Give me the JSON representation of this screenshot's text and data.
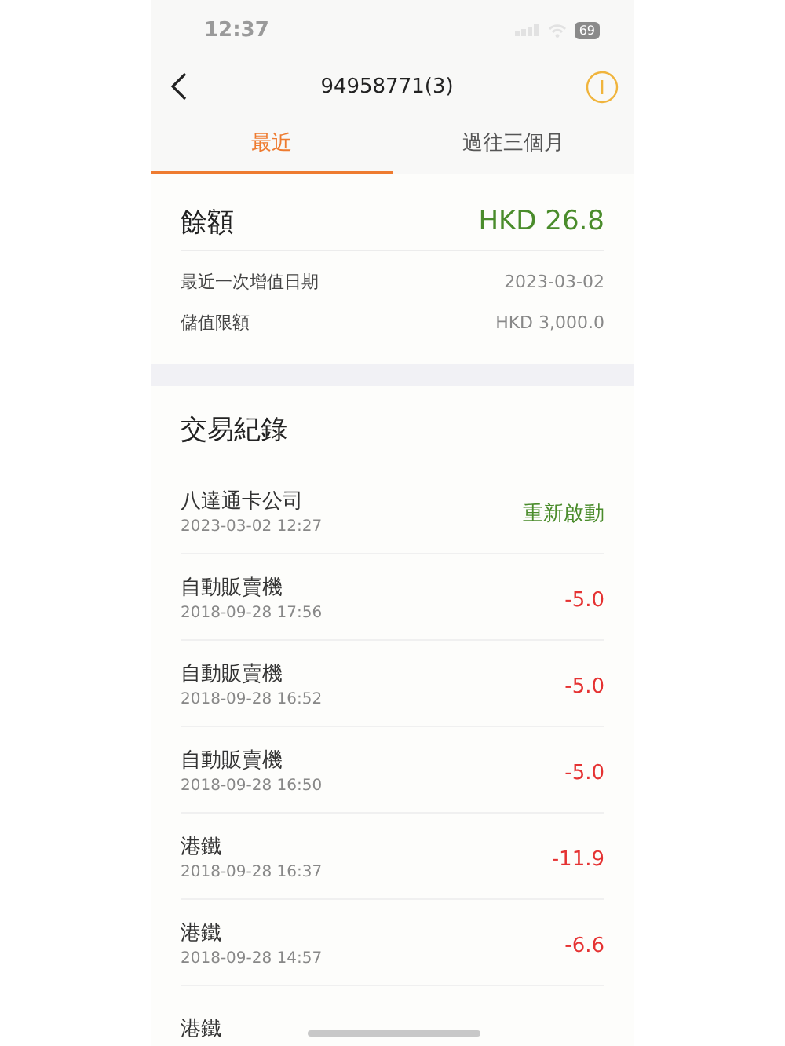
{
  "status_bar": {
    "time": "12:37",
    "battery": "69"
  },
  "nav": {
    "title": "94958771(3)"
  },
  "tabs": [
    {
      "label": "最近",
      "selected": true
    },
    {
      "label": "過往三個月",
      "selected": false
    }
  ],
  "balance": {
    "label": "餘額",
    "amount": "HKD 26.8",
    "details": [
      {
        "label": "最近一次增值日期",
        "value": "2023-03-02"
      },
      {
        "label": "儲值限額",
        "value": "HKD 3,000.0"
      }
    ]
  },
  "transactions": {
    "title": "交易紀錄",
    "rows": [
      {
        "name": "八達通卡公司",
        "time": "2023-03-02 12:27",
        "amount": "重新啟動",
        "kind": "status"
      },
      {
        "name": "自動販賣機",
        "time": "2018-09-28 17:56",
        "amount": "-5.0",
        "kind": "debit"
      },
      {
        "name": "自動販賣機",
        "time": "2018-09-28 16:52",
        "amount": "-5.0",
        "kind": "debit"
      },
      {
        "name": "自動販賣機",
        "time": "2018-09-28 16:50",
        "amount": "-5.0",
        "kind": "debit"
      },
      {
        "name": "港鐵",
        "time": "2018-09-28 16:37",
        "amount": "-11.9",
        "kind": "debit"
      },
      {
        "name": "港鐵",
        "time": "2018-09-28 14:57",
        "amount": "-6.6",
        "kind": "debit"
      },
      {
        "name": "港鐵"
      }
    ]
  }
}
